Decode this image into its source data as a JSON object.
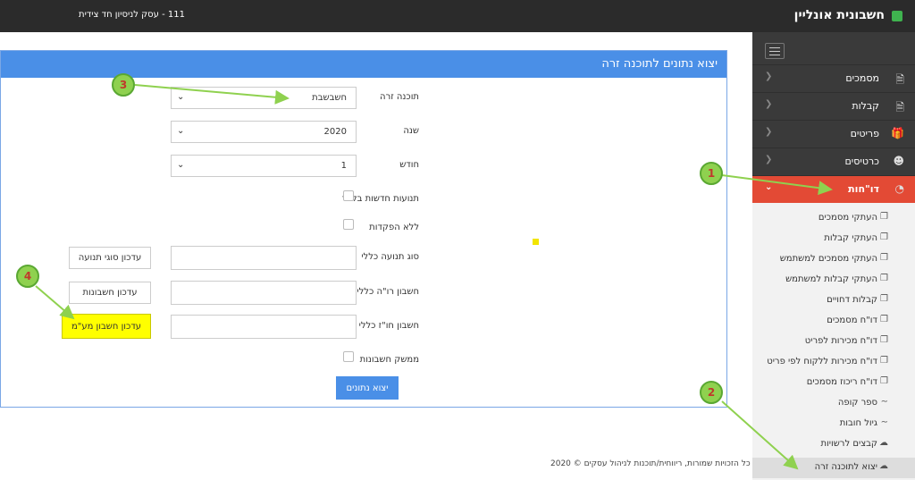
{
  "header": {
    "brand": "חשבונית אונליין",
    "company": "111 - עסק לניסיון חד צידית"
  },
  "sidebar": {
    "items": [
      {
        "label": "מסמכים",
        "icon": "document-icon"
      },
      {
        "label": "קבלות",
        "icon": "document-icon"
      },
      {
        "label": "פריטים",
        "icon": "gift-icon"
      },
      {
        "label": "כרטיסים",
        "icon": "user-icon"
      },
      {
        "label": "דו\"חות",
        "icon": "pie-chart-icon",
        "active": true
      }
    ],
    "subitems": [
      {
        "label": "העתקי מסמכים",
        "icon": "copy-icon"
      },
      {
        "label": "העתקי קבלות",
        "icon": "copy-icon"
      },
      {
        "label": "העתקי מסמכים למשתמש",
        "icon": "copy-icon"
      },
      {
        "label": "העתקי קבלות למשתמש",
        "icon": "copy-icon"
      },
      {
        "label": "קבלות דחויים",
        "icon": "copy-icon"
      },
      {
        "label": "דו\"ח מסמכים",
        "icon": "copy-icon"
      },
      {
        "label": "דו\"ח מכירות לפריט",
        "icon": "copy-icon"
      },
      {
        "label": "דו\"ח מכירות ללקוח לפי פריט",
        "icon": "copy-icon"
      },
      {
        "label": "דו\"ח ריכוז מסמכים",
        "icon": "copy-icon"
      },
      {
        "label": "ספר קופה",
        "icon": "trend-icon"
      },
      {
        "label": "גיול חובות",
        "icon": "trend-icon"
      },
      {
        "label": "קבצים לרשויות",
        "icon": "cloud-icon"
      },
      {
        "label": "יצוא לתוכנה זרה",
        "icon": "cloud-upload-icon",
        "current": true
      }
    ]
  },
  "form": {
    "title": "יצוא נתונים לתוכנה זרה",
    "software_label": "תוכנה זרה",
    "software_value": "חשבשבת",
    "year_label": "שנה",
    "year_value": "2020",
    "month_label": "חודש",
    "month_value": "1",
    "new_only_label": "תנועות חדשות בלבד",
    "no_deposits_label": "ללא הפקדות",
    "movement_type_label": "סוג תנועה כללי",
    "movement_type_button": "עדכון סוגי תנועה",
    "profit_account_label": "חשבון רו\"ה כללי",
    "profit_account_button": "עדכון חשבונות",
    "general_account_label": "חשבון חו\"ז כללי",
    "vat_account_button": "עדכון חשבון מע\"מ",
    "interface_label": "ממשק חשבונות",
    "export_button": "יצוא נתונים"
  },
  "footer": {
    "copyright": "כל הזכויות שמורות, ריווחית/תוכנות לניהול עסקים © 2020"
  },
  "annotations": [
    "1",
    "2",
    "3",
    "4"
  ],
  "colors": {
    "accent": "#4a8fe7",
    "active_nav": "#e34a35",
    "highlight": "#ffff00",
    "annotation": "#8fd14f"
  }
}
